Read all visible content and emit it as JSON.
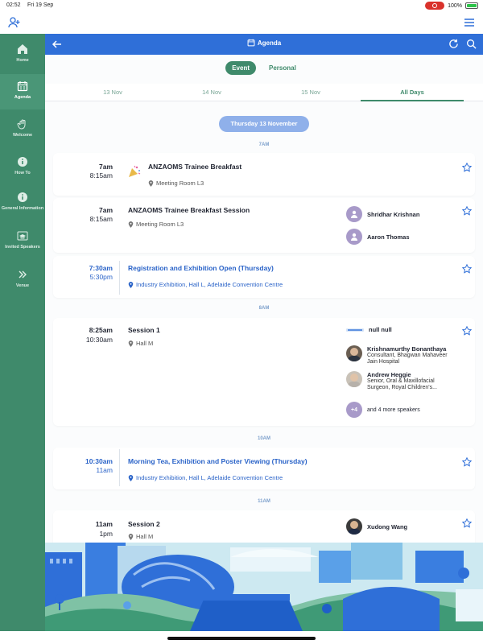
{
  "status": {
    "time": "02:52",
    "date": "Fri 19 Sep",
    "battery": "100%"
  },
  "sidebar": {
    "items": [
      {
        "label": "Home",
        "icon": "home-icon"
      },
      {
        "label": "Agenda",
        "icon": "calendar-icon"
      },
      {
        "label": "Welcome",
        "icon": "wave-hand-icon"
      },
      {
        "label": "How To",
        "icon": "info-icon"
      },
      {
        "label": "General Information",
        "icon": "info-icon"
      },
      {
        "label": "Invited Speakers",
        "icon": "graduation-cap-icon"
      },
      {
        "label": "Venue",
        "icon": "chevrons-right-icon"
      }
    ]
  },
  "appbar": {
    "title": "Agenda"
  },
  "segments": {
    "event": "Event",
    "personal": "Personal"
  },
  "days": [
    "13 Nov",
    "14 Nov",
    "15 Nov",
    "All Days"
  ],
  "date_chip": "Thursday 13 November",
  "hours": [
    "7AM",
    "8AM",
    "10AM",
    "11AM"
  ],
  "sessions": [
    {
      "start": "7am",
      "end": "8:15am",
      "title": "ANZAOMS Trainee Breakfast",
      "location": "Meeting Room L3"
    },
    {
      "start": "7am",
      "end": "8:15am",
      "title": "ANZAOMS Trainee Breakfast Session",
      "location": "Meeting Room L3",
      "speakers": [
        "Shridhar Krishnan",
        "Aaron Thomas"
      ]
    },
    {
      "start": "7:30am",
      "end": "5:30pm",
      "title": "Registration and Exhibition Open (Thursday)",
      "location": "Industry Exhibition, Hall L, Adelaide Convention Centre"
    },
    {
      "start": "8:25am",
      "end": "10:30am",
      "title": "Session 1",
      "location": "Hall M",
      "sponsor": "null null",
      "speaker1_name": "Krishnamurthy Bonanthaya",
      "speaker1_role": "Consultant, Bhagwan Mahaveer Jain Hospital",
      "speaker2_name": "Andrew Heggie",
      "speaker2_role": "Senior, Oral & Maxillofacial Surgeon, Royal Children's...",
      "more_count": "+4",
      "more_label": "and 4 more speakers"
    },
    {
      "start": "10:30am",
      "end": "11am",
      "title": "Morning Tea, Exhibition and Poster Viewing (Thursday)",
      "location": "Industry Exhibition, Hall L, Adelaide Convention Centre"
    },
    {
      "start": "11am",
      "end": "1pm",
      "title": "Session 2",
      "location": "Hall M",
      "speaker": "Xudong Wang"
    }
  ],
  "colors": {
    "sidebar": "#3f8a6b",
    "appbar": "#2f6fd8",
    "accent": "#3f8a6b"
  }
}
